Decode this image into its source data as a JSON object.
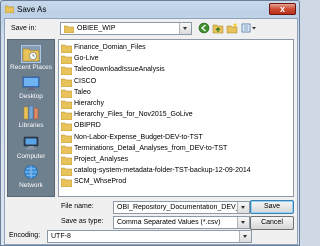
{
  "window": {
    "title": "Save As",
    "close_label": "x"
  },
  "savein": {
    "label": "Save in:",
    "value": "OBIEE_WIP"
  },
  "toolbar": {
    "icons": [
      "back-icon",
      "up-folder-icon",
      "new-folder-icon",
      "views-menu-icon"
    ]
  },
  "places": [
    {
      "label": "Recent Places",
      "icon": "recent-places-icon"
    },
    {
      "label": "Desktop",
      "icon": "desktop-icon"
    },
    {
      "label": "Libraries",
      "icon": "libraries-icon"
    },
    {
      "label": "Computer",
      "icon": "computer-icon"
    },
    {
      "label": "Network",
      "icon": "network-icon"
    }
  ],
  "files": [
    "Finance_Domian_Files",
    "Go-Live",
    "TaleoDownloadIssueAnalysis",
    "CISCO",
    "Taleo",
    "Hierarchy",
    "Hierarchy_Files_for_Nov2015_GoLive",
    "OBIPRD",
    "Non-Labor-Expense_Budget-DEV-to-TST",
    "Terminations_Detail_Analyses_from_DEV-to-TST",
    "Project_Analyses",
    "catalog-system-metadata-folder-TST-backup-12-09-2014",
    "SCM_WhseProd"
  ],
  "form": {
    "filename_label": "File name:",
    "filename_value": "OBI_Repository_Documentation_DEV_2017 07",
    "savetype_label": "Save as type:",
    "savetype_value": "Comma Separated Values (*.csv)",
    "encoding_label": "Encoding:",
    "encoding_value": "UTF-8"
  },
  "buttons": {
    "save": "Save",
    "cancel": "Cancel"
  },
  "colors": {
    "folder": "#e8c25a",
    "close": "#c8402b",
    "places_bg": "#6e7f8e"
  }
}
